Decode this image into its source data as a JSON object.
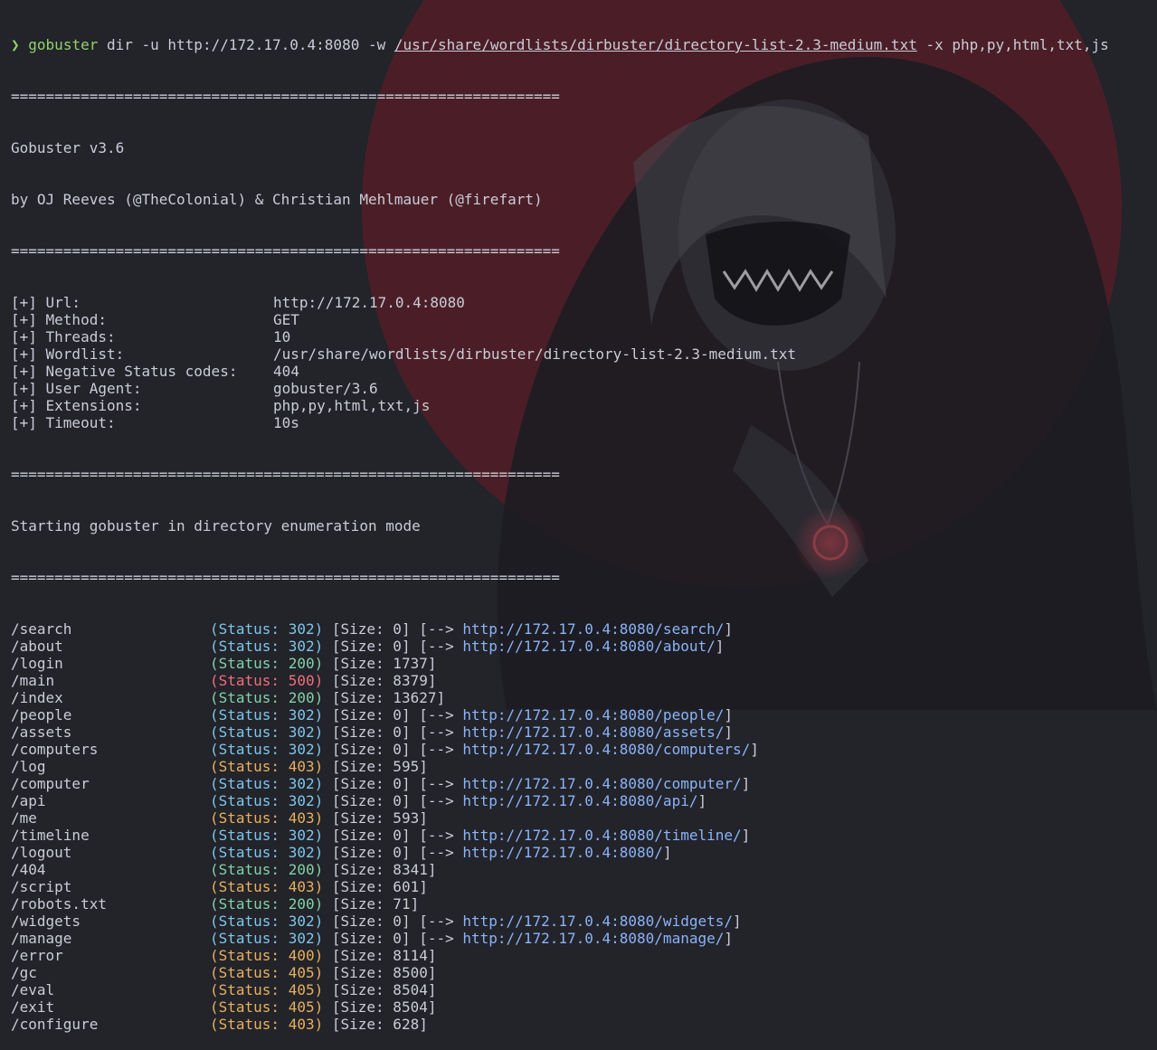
{
  "colors": {
    "background": "#23232a",
    "text": "#c9cdd6",
    "prompt": "#8fd46a",
    "status_302": "#7cc7ea",
    "status_200": "#7fd3a8",
    "status_500": "#ef6f79",
    "status_4xx": "#e8b15c",
    "url": "#8ab4f8",
    "wallpaper_accent": "#7a1d28"
  },
  "command": {
    "prompt_symbol": "❯",
    "program": "gobuster",
    "args_before_path": " dir -u http://172.17.0.4:8080 -w ",
    "wordlist_path": "/usr/share/wordlists/dirbuster/directory-list-2.3-medium.txt",
    "args_after_path": " -x php,py,html,txt,js"
  },
  "separator": "===============================================================",
  "banner": {
    "version": "Gobuster v3.6",
    "authors": "by OJ Reeves (@TheColonial) & Christian Mehlmauer (@firefart)"
  },
  "config": [
    {
      "key": "[+] Url:",
      "value": "http://172.17.0.4:8080"
    },
    {
      "key": "[+] Method:",
      "value": "GET"
    },
    {
      "key": "[+] Threads:",
      "value": "10"
    },
    {
      "key": "[+] Wordlist:",
      "value": "/usr/share/wordlists/dirbuster/directory-list-2.3-medium.txt"
    },
    {
      "key": "[+] Negative Status codes:",
      "value": "404"
    },
    {
      "key": "[+] User Agent:",
      "value": "gobuster/3.6"
    },
    {
      "key": "[+] Extensions:",
      "value": "php,py,html,txt,js"
    },
    {
      "key": "[+] Timeout:",
      "value": "10s"
    }
  ],
  "start_message": "Starting gobuster in directory enumeration mode",
  "results": [
    {
      "path": "/search",
      "status": "(Status: 302)",
      "cls": "c302",
      "size": "[Size: 0]",
      "redirect": "http://172.17.0.4:8080/search/"
    },
    {
      "path": "/about",
      "status": "(Status: 302)",
      "cls": "c302",
      "size": "[Size: 0]",
      "redirect": "http://172.17.0.4:8080/about/"
    },
    {
      "path": "/login",
      "status": "(Status: 200)",
      "cls": "c200",
      "size": "[Size: 1737]",
      "redirect": ""
    },
    {
      "path": "/main",
      "status": "(Status: 500)",
      "cls": "c500",
      "size": "[Size: 8379]",
      "redirect": ""
    },
    {
      "path": "/index",
      "status": "(Status: 200)",
      "cls": "c200",
      "size": "[Size: 13627]",
      "redirect": ""
    },
    {
      "path": "/people",
      "status": "(Status: 302)",
      "cls": "c302",
      "size": "[Size: 0]",
      "redirect": "http://172.17.0.4:8080/people/"
    },
    {
      "path": "/assets",
      "status": "(Status: 302)",
      "cls": "c302",
      "size": "[Size: 0]",
      "redirect": "http://172.17.0.4:8080/assets/"
    },
    {
      "path": "/computers",
      "status": "(Status: 302)",
      "cls": "c302",
      "size": "[Size: 0]",
      "redirect": "http://172.17.0.4:8080/computers/"
    },
    {
      "path": "/log",
      "status": "(Status: 403)",
      "cls": "c4xx",
      "size": "[Size: 595]",
      "redirect": ""
    },
    {
      "path": "/computer",
      "status": "(Status: 302)",
      "cls": "c302",
      "size": "[Size: 0]",
      "redirect": "http://172.17.0.4:8080/computer/"
    },
    {
      "path": "/api",
      "status": "(Status: 302)",
      "cls": "c302",
      "size": "[Size: 0]",
      "redirect": "http://172.17.0.4:8080/api/"
    },
    {
      "path": "/me",
      "status": "(Status: 403)",
      "cls": "c4xx",
      "size": "[Size: 593]",
      "redirect": ""
    },
    {
      "path": "/timeline",
      "status": "(Status: 302)",
      "cls": "c302",
      "size": "[Size: 0]",
      "redirect": "http://172.17.0.4:8080/timeline/"
    },
    {
      "path": "/logout",
      "status": "(Status: 302)",
      "cls": "c302",
      "size": "[Size: 0]",
      "redirect": "http://172.17.0.4:8080/"
    },
    {
      "path": "/404",
      "status": "(Status: 200)",
      "cls": "c200",
      "size": "[Size: 8341]",
      "redirect": ""
    },
    {
      "path": "/script",
      "status": "(Status: 403)",
      "cls": "c4xx",
      "size": "[Size: 601]",
      "redirect": ""
    },
    {
      "path": "/robots.txt",
      "status": "(Status: 200)",
      "cls": "c200",
      "size": "[Size: 71]",
      "redirect": ""
    },
    {
      "path": "/widgets",
      "status": "(Status: 302)",
      "cls": "c302",
      "size": "[Size: 0]",
      "redirect": "http://172.17.0.4:8080/widgets/"
    },
    {
      "path": "/manage",
      "status": "(Status: 302)",
      "cls": "c302",
      "size": "[Size: 0]",
      "redirect": "http://172.17.0.4:8080/manage/"
    },
    {
      "path": "/error",
      "status": "(Status: 400)",
      "cls": "c4xx",
      "size": "[Size: 8114]",
      "redirect": ""
    },
    {
      "path": "/gc",
      "status": "(Status: 405)",
      "cls": "c4xx",
      "size": "[Size: 8500]",
      "redirect": ""
    },
    {
      "path": "/eval",
      "status": "(Status: 405)",
      "cls": "c4xx",
      "size": "[Size: 8504]",
      "redirect": ""
    },
    {
      "path": "/exit",
      "status": "(Status: 405)",
      "cls": "c4xx",
      "size": "[Size: 8504]",
      "redirect": ""
    },
    {
      "path": "/configure",
      "status": "(Status: 403)",
      "cls": "c4xx",
      "size": "[Size: 628]",
      "redirect": ""
    }
  ]
}
